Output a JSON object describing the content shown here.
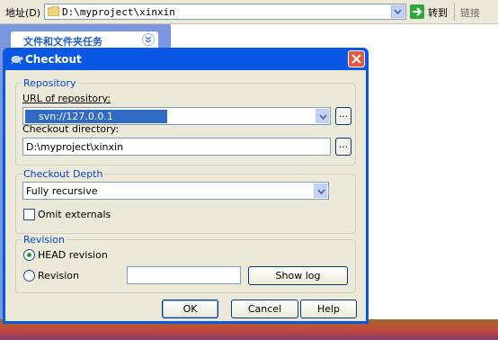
{
  "explorer": {
    "address_label": "地址(D)",
    "address_value": "D:\\myproject\\xinxin",
    "go_label": "转到",
    "links_label": "链接",
    "task_title": "文件和文件夹任务"
  },
  "dialog": {
    "title": "Checkout",
    "repository_group": "Repository",
    "url_label": "URL of repository:",
    "url_value": "svn://127.0.0.1",
    "checkout_dir_label": "Checkout directory:",
    "checkout_dir_value": "D:\\myproject\\xinxin",
    "browse_label": "...",
    "depth_group": "Checkout Depth",
    "depth_value": "Fully recursive",
    "omit_externals_label": "Omit externals",
    "omit_externals_checked": false,
    "revision_group": "Revision",
    "head_revision_label": "HEAD revision",
    "head_selected": true,
    "revision_label": "Revision",
    "revision_value": "",
    "show_log_label": "Show log",
    "ok_label": "OK",
    "cancel_label": "Cancel",
    "help_label": "Help"
  },
  "colors": {
    "titlebar": "#0a57e4",
    "group_label": "#0046d5",
    "selection": "#316ac5",
    "taskpane": "#7a96df"
  },
  "icons": [
    "folder-icon",
    "chevron-down-icon",
    "go-arrow-icon",
    "collapse-chevrons-icon",
    "tortoise-icon",
    "close-icon"
  ]
}
